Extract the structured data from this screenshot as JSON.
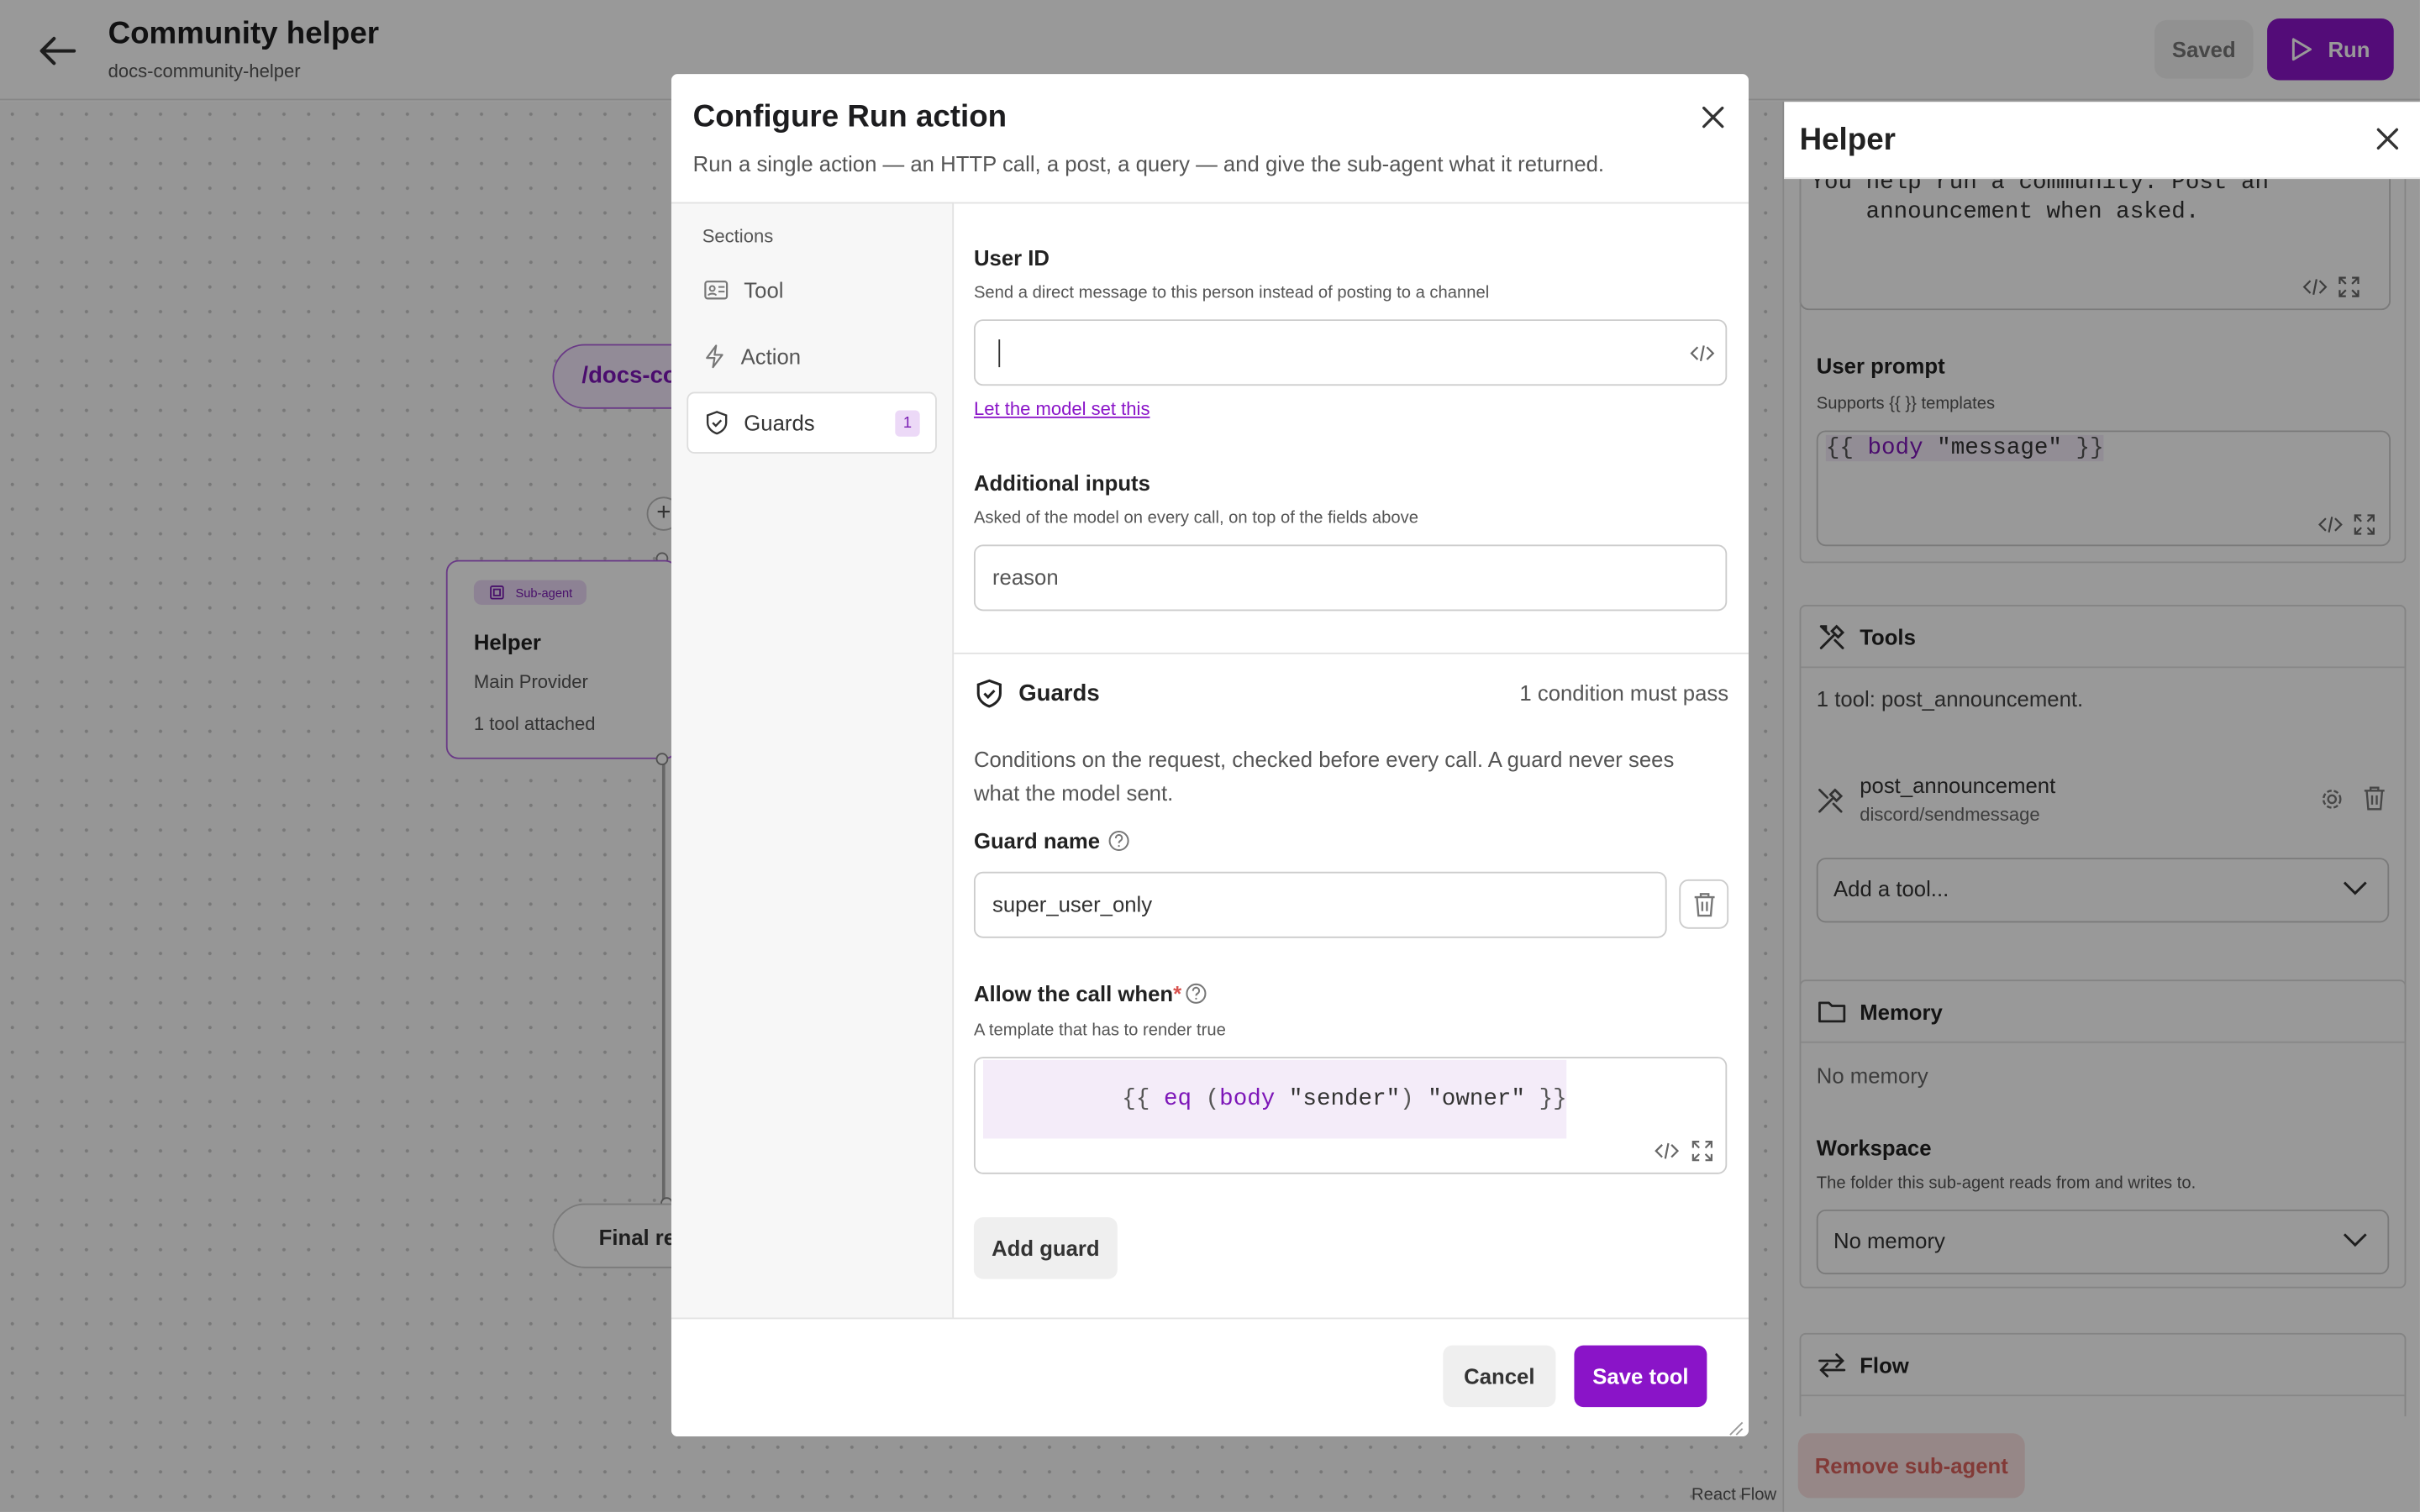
{
  "header": {
    "title": "Community helper",
    "subtitle": "docs-community-helper",
    "saved_label": "Saved",
    "run_label": "Run"
  },
  "canvas": {
    "trigger_pill": "/docs-co",
    "node": {
      "chip": "Sub-agent",
      "title": "Helper",
      "provider": "Main Provider",
      "tools": "1 tool attached"
    },
    "final_node": "Final re",
    "watermark": "React Flow"
  },
  "helper_panel": {
    "title": "Helper",
    "system_prompt_line1": "You help run a community. Post an",
    "system_prompt_line2": "    announcement when asked.",
    "user_prompt_label": "User prompt",
    "user_prompt_hint": "Supports {{ }} templates",
    "user_prompt_value": {
      "open": "{{",
      "kw": "body",
      "str": "\"message\"",
      "close": "}}"
    },
    "tools": {
      "header": "Tools",
      "summary": "1 tool: post_announcement.",
      "item_name": "post_announcement",
      "item_path": "discord/sendmessage",
      "add_placeholder": "Add a tool..."
    },
    "memory": {
      "header": "Memory",
      "value": "No memory",
      "workspace_label": "Workspace",
      "workspace_hint": "The folder this sub-agent reads from and writes to.",
      "workspace_select": "No memory"
    },
    "flow": {
      "header": "Flow"
    },
    "remove_label": "Remove sub-agent"
  },
  "modal": {
    "title": "Configure Run action",
    "description": "Run a single action — an HTTP call, a post, a query — and give the sub-agent what it returned.",
    "sections_label": "Sections",
    "nav": [
      {
        "label": "Tool"
      },
      {
        "label": "Action"
      },
      {
        "label": "Guards",
        "badge": "1"
      }
    ],
    "user_id": {
      "label": "User ID",
      "hint": "Send a direct message to this person instead of posting to a channel",
      "value": "",
      "link": "Let the model set this"
    },
    "additional": {
      "label": "Additional inputs",
      "hint": "Asked of the model on every call, on top of the fields above",
      "value": "reason"
    },
    "guards": {
      "header": "Guards",
      "status": "1 condition must pass",
      "description_line1": "Conditions on the request, checked before every call. A guard never sees",
      "description_line2": "what the model sent.",
      "name_label": "Guard name",
      "name_value": "super_user_only",
      "allow_label": "Allow the call when",
      "allow_hint": "A template that has to render true",
      "template": {
        "p1": "{{",
        "p2": "eq",
        "p3": "(",
        "p4": "body",
        "p5": "\"sender\"",
        "p6": ")",
        "p7": "\"owner\"",
        "p8": "}}"
      },
      "add_label": "Add guard"
    },
    "cancel_label": "Cancel",
    "save_label": "Save tool"
  },
  "colors": {
    "accent": "#8a14c8",
    "accent_light": "#ecd9f7",
    "danger": "#d9625c"
  }
}
